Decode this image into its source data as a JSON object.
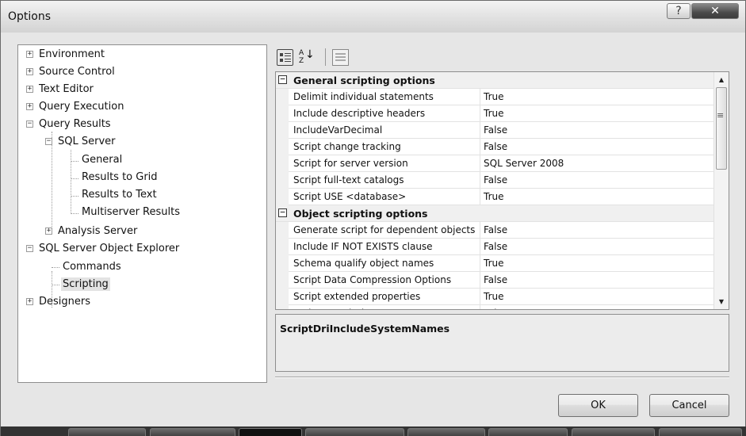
{
  "window": {
    "title": "Options",
    "help_glyph": "?",
    "close_glyph": "✕"
  },
  "tree": {
    "items": [
      {
        "label": "Environment"
      },
      {
        "label": "Source Control"
      },
      {
        "label": "Text Editor"
      },
      {
        "label": "Query Execution"
      },
      {
        "label": "Query Results"
      },
      {
        "label": "SQL Server"
      },
      {
        "label": "General"
      },
      {
        "label": "Results to Grid"
      },
      {
        "label": "Results to Text"
      },
      {
        "label": "Multiserver Results"
      },
      {
        "label": "Analysis Server"
      },
      {
        "label": "SQL Server Object Explorer"
      },
      {
        "label": "Commands"
      },
      {
        "label": "Scripting",
        "selected": true
      },
      {
        "label": "Designers"
      }
    ]
  },
  "toolbar": {
    "alpha_top": "A",
    "alpha_bottom": "Z",
    "alpha_arrow": "↓"
  },
  "grid": {
    "categories": [
      {
        "label": "General scripting options",
        "toggle": "⊟",
        "rows": [
          {
            "name": "Delimit individual statements",
            "value": "True"
          },
          {
            "name": "Include descriptive headers",
            "value": "True"
          },
          {
            "name": "IncludeVarDecimal",
            "value": "False"
          },
          {
            "name": "Script change tracking",
            "value": "False"
          },
          {
            "name": "Script for server version",
            "value": "SQL Server 2008"
          },
          {
            "name": "Script full-text catalogs",
            "value": "False"
          },
          {
            "name": "Script USE <database>",
            "value": "True"
          }
        ]
      },
      {
        "label": "Object scripting options",
        "toggle": "⊟",
        "rows": [
          {
            "name": "Generate script for dependent objects",
            "value": "False"
          },
          {
            "name": "Include IF NOT EXISTS clause",
            "value": "False"
          },
          {
            "name": "Schema qualify object names",
            "value": "True"
          },
          {
            "name": "Script Data Compression Options",
            "value": "False"
          },
          {
            "name": "Script extended properties",
            "value": "True"
          },
          {
            "name": "Script permissions",
            "value": "False"
          }
        ]
      }
    ],
    "scroll_up": "▲",
    "scroll_down": "▼",
    "scroll_grip": "≡"
  },
  "description": {
    "title": "ScriptDriIncludeSystemNames"
  },
  "buttons": {
    "ok": "OK",
    "cancel": "Cancel"
  }
}
